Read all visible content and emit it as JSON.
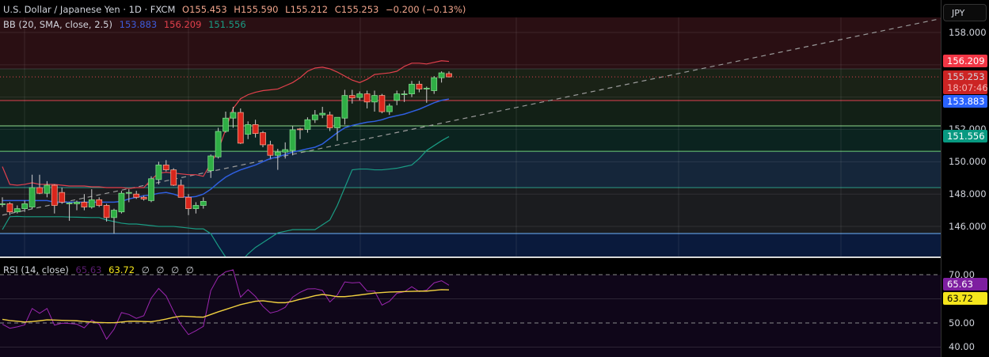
{
  "header": {
    "title": "U.S. Dollar / Japanese Yen · 1D · FXCM",
    "open": "O155.453",
    "high": "H155.590",
    "low": "L155.212",
    "close": "C155.253",
    "change": "−0.200 (−0.13%)"
  },
  "bb_legend": {
    "label": "BB (20, SMA, close, 2.5)",
    "basis": "153.883",
    "upper": "156.209",
    "lower": "151.556"
  },
  "rsi_legend": {
    "label": "RSI (14, close)",
    "rsi": "65.63",
    "ma": "63.72",
    "empty": [
      "∅",
      "∅",
      "∅",
      "∅"
    ]
  },
  "axis": {
    "currency": "JPY",
    "price_ticks": [
      "158.000",
      "152.000",
      "150.000",
      "148.000",
      "146.000"
    ],
    "rsi_ticks": [
      "70.00",
      "50.00",
      "40.00"
    ],
    "tags": {
      "bb_upper": "156.209",
      "last_price": "155.253",
      "countdown": "18:07:46",
      "bb_basis": "153.883",
      "bb_lower": "151.556",
      "rsi": "65.63",
      "rsi_ma": "63.72"
    }
  },
  "colors": {
    "up": "#2fae45",
    "down": "#d9261c",
    "bb_upper": "#f23645",
    "bb_basis": "#2962ff",
    "bb_lower": "#089981",
    "rsi": "#9c27b0",
    "rsi_ma": "#f5e61c"
  },
  "chart_data": [
    {
      "type": "candlestick",
      "title": "U.S. Dollar / Japanese Yen · 1D · FXCM",
      "ylim": [
        144.1,
        159.0
      ],
      "ohlc": [
        [
          147.35,
          147.8,
          147.2,
          147.4
        ],
        [
          147.4,
          147.5,
          146.7,
          146.9
        ],
        [
          146.9,
          147.3,
          146.8,
          147.1
        ],
        [
          147.1,
          147.6,
          146.9,
          147.4
        ],
        [
          147.2,
          149.2,
          147.1,
          148.4
        ],
        [
          148.4,
          149.2,
          148.0,
          148.05
        ],
        [
          148.05,
          148.8,
          147.8,
          148.55
        ],
        [
          148.55,
          148.6,
          146.8,
          147.3
        ],
        [
          148.1,
          148.4,
          147.4,
          147.5
        ],
        [
          147.45,
          147.5,
          146.35,
          147.45
        ],
        [
          147.4,
          147.6,
          147.0,
          147.5
        ],
        [
          147.5,
          148.0,
          147.0,
          147.2
        ],
        [
          147.2,
          148.3,
          147.1,
          147.65
        ],
        [
          147.65,
          147.8,
          147.2,
          147.3
        ],
        [
          147.3,
          147.4,
          146.3,
          146.55
        ],
        [
          146.55,
          147.1,
          145.55,
          147.0
        ],
        [
          146.9,
          148.2,
          146.8,
          148.05
        ],
        [
          148.05,
          148.3,
          147.5,
          148.1
        ],
        [
          148.0,
          148.2,
          147.7,
          147.8
        ],
        [
          147.8,
          147.9,
          147.6,
          147.7
        ],
        [
          147.6,
          149.1,
          147.5,
          148.95
        ],
        [
          148.9,
          150.0,
          148.6,
          149.8
        ],
        [
          149.8,
          150.1,
          149.4,
          149.5
        ],
        [
          149.5,
          149.6,
          148.5,
          148.55
        ],
        [
          148.55,
          148.9,
          147.8,
          147.8
        ],
        [
          147.8,
          148.0,
          146.7,
          147.1
        ],
        [
          147.1,
          147.5,
          146.8,
          147.3
        ],
        [
          147.3,
          147.8,
          147.1,
          147.55
        ],
        [
          149.45,
          150.45,
          149.0,
          150.36
        ],
        [
          150.3,
          152.1,
          150.2,
          151.88
        ],
        [
          151.88,
          153.1,
          151.8,
          152.7
        ],
        [
          152.7,
          153.4,
          152.1,
          153.05
        ],
        [
          153.05,
          153.3,
          151.1,
          151.15
        ],
        [
          151.7,
          152.5,
          151.4,
          152.3
        ],
        [
          152.3,
          152.6,
          151.5,
          151.75
        ],
        [
          151.8,
          151.9,
          150.9,
          151.05
        ],
        [
          151.05,
          151.3,
          150.2,
          150.4
        ],
        [
          150.4,
          150.8,
          149.5,
          150.6
        ],
        [
          150.6,
          151.2,
          150.2,
          150.75
        ],
        [
          150.7,
          152.2,
          150.4,
          151.98
        ],
        [
          152.03,
          152.1,
          151.4,
          152.0
        ],
        [
          152.0,
          152.75,
          151.8,
          152.6
        ],
        [
          152.6,
          153.2,
          152.4,
          152.9
        ],
        [
          152.9,
          153.4,
          152.7,
          153.0
        ],
        [
          152.9,
          153.1,
          151.9,
          152.1
        ],
        [
          152.1,
          152.7,
          151.3,
          152.75
        ],
        [
          152.7,
          154.45,
          152.3,
          154.1
        ],
        [
          154.1,
          154.45,
          153.6,
          153.95
        ],
        [
          153.98,
          154.35,
          153.8,
          154.2
        ],
        [
          154.2,
          154.4,
          153.3,
          153.7
        ],
        [
          153.7,
          154.4,
          153.1,
          154.1
        ],
        [
          154.1,
          154.2,
          153.0,
          153.1
        ],
        [
          153.1,
          153.6,
          152.9,
          153.45
        ],
        [
          153.8,
          154.4,
          153.5,
          154.2
        ],
        [
          154.2,
          154.4,
          153.7,
          154.2
        ],
        [
          154.2,
          155.0,
          154.0,
          154.8
        ],
        [
          154.8,
          155.0,
          154.3,
          154.5
        ],
        [
          154.55,
          154.65,
          153.65,
          154.55
        ],
        [
          154.4,
          155.3,
          154.2,
          155.2
        ],
        [
          155.2,
          155.59,
          154.9,
          155.5
        ],
        [
          155.453,
          155.59,
          155.212,
          155.253
        ]
      ],
      "bb_upper": [
        149.7,
        148.6,
        148.55,
        148.6,
        148.7,
        148.6,
        148.6,
        148.6,
        148.55,
        148.5,
        148.5,
        148.5,
        148.45,
        148.45,
        148.4,
        148.4,
        148.4,
        148.35,
        148.4,
        148.4,
        148.9,
        149.3,
        149.35,
        149.3,
        149.25,
        149.2,
        149.2,
        149.1,
        149.9,
        150.7,
        152.0,
        153.3,
        153.9,
        154.15,
        154.3,
        154.4,
        154.45,
        154.5,
        154.7,
        154.9,
        155.2,
        155.6,
        155.8,
        155.85,
        155.75,
        155.55,
        155.3,
        155.05,
        154.9,
        155.1,
        155.4,
        155.45,
        155.5,
        155.6,
        155.9,
        156.1,
        156.1,
        156.05,
        156.15,
        156.25,
        156.209
      ],
      "bb_basis": [
        147.6,
        147.6,
        147.6,
        147.6,
        147.6,
        147.6,
        147.6,
        147.5,
        147.5,
        147.5,
        147.5,
        147.5,
        147.5,
        147.5,
        147.5,
        147.5,
        147.55,
        147.7,
        147.8,
        147.9,
        147.95,
        148.05,
        148.1,
        148.0,
        147.85,
        147.8,
        147.85,
        148.0,
        148.3,
        148.7,
        149.05,
        149.3,
        149.5,
        149.65,
        149.8,
        150.0,
        150.2,
        150.3,
        150.45,
        150.6,
        150.7,
        150.8,
        150.9,
        151.1,
        151.45,
        151.8,
        152.1,
        152.25,
        152.35,
        152.45,
        152.5,
        152.6,
        152.75,
        152.85,
        152.95,
        153.1,
        153.25,
        153.45,
        153.65,
        153.8,
        153.883
      ],
      "bb_lower": [
        145.8,
        146.6,
        146.62,
        146.6,
        146.6,
        146.6,
        146.6,
        146.6,
        146.6,
        146.58,
        146.57,
        146.56,
        146.55,
        146.55,
        146.4,
        146.3,
        146.2,
        146.15,
        146.15,
        146.1,
        146.05,
        146.0,
        146.0,
        146.0,
        145.95,
        145.9,
        145.85,
        145.85,
        145.55,
        144.8,
        144.1,
        143.7,
        143.8,
        144.3,
        144.7,
        145.0,
        145.3,
        145.6,
        145.7,
        145.8,
        145.8,
        145.8,
        145.8,
        146.1,
        146.4,
        147.3,
        148.4,
        149.5,
        149.55,
        149.55,
        149.5,
        149.5,
        149.55,
        149.6,
        149.7,
        149.8,
        150.2,
        150.7,
        151.0,
        151.3,
        151.556
      ],
      "trendline": {
        "from": {
          "bar": 0,
          "price": 146.7
        },
        "to": {
          "bar": 126,
          "price": 158.85
        }
      },
      "levels": [
        {
          "top": 158.93,
          "bottom": 155.75,
          "fill": "#2a0f13",
          "line": "#3a3a3a"
        },
        {
          "top": 155.75,
          "bottom": 153.79,
          "fill": "#1a2216",
          "line": "#e04050"
        },
        {
          "top": 153.79,
          "bottom": 152.22,
          "fill": "#122016",
          "line": "#8fd88a"
        },
        {
          "top": 152.22,
          "bottom": 150.65,
          "fill": "#0b231f",
          "line": "#6fcf7a"
        },
        {
          "top": 150.65,
          "bottom": 148.4,
          "fill": "#15263a",
          "line": "#2a9a86"
        },
        {
          "top": 148.4,
          "bottom": 145.56,
          "fill": "#1b1c1f",
          "line": "#6fb4ff"
        },
        {
          "top": 145.56,
          "bottom": 144.0,
          "fill": "#0a1a3c",
          "line": "#9a9a9a"
        }
      ]
    },
    {
      "type": "line",
      "title": "RSI (14, close)",
      "ylim": [
        36.0,
        77.0
      ],
      "rsi": [
        49.5,
        47.8,
        48.4,
        49.2,
        56.0,
        54.0,
        56.0,
        49.1,
        49.9,
        49.8,
        49.5,
        48.0,
        51.2,
        49.5,
        43.3,
        47.4,
        54.3,
        53.5,
        51.9,
        53.0,
        60.3,
        64.3,
        61.2,
        54.8,
        49.3,
        45.2,
        46.8,
        48.6,
        63.4,
        69.0,
        71.2,
        72.0,
        60.7,
        63.8,
        61.0,
        56.9,
        54.1,
        54.9,
        56.5,
        60.7,
        62.7,
        64.1,
        64.2,
        63.5,
        58.7,
        61.6,
        67.0,
        66.6,
        66.8,
        63.2,
        63.2,
        57.4,
        59.0,
        62.3,
        62.9,
        65.0,
        63.0,
        63.6,
        66.6,
        67.5,
        65.63
      ],
      "rsi_ma": [
        51.5,
        51.0,
        50.7,
        50.4,
        50.6,
        50.9,
        51.3,
        51.2,
        51.1,
        51.0,
        50.9,
        50.6,
        50.4,
        50.2,
        50.1,
        50.1,
        50.4,
        50.7,
        50.7,
        50.6,
        50.5,
        51.0,
        51.6,
        52.3,
        52.8,
        52.7,
        52.5,
        52.4,
        53.5,
        54.6,
        55.6,
        56.6,
        57.6,
        58.3,
        59.0,
        59.2,
        58.8,
        58.4,
        58.4,
        59.0,
        59.8,
        60.5,
        61.3,
        61.8,
        61.4,
        60.9,
        60.9,
        61.2,
        61.6,
        62.0,
        62.4,
        62.6,
        62.8,
        62.9,
        63.0,
        63.1,
        63.2,
        63.2,
        63.5,
        63.8,
        63.72
      ],
      "bands": [
        70,
        50
      ]
    }
  ]
}
